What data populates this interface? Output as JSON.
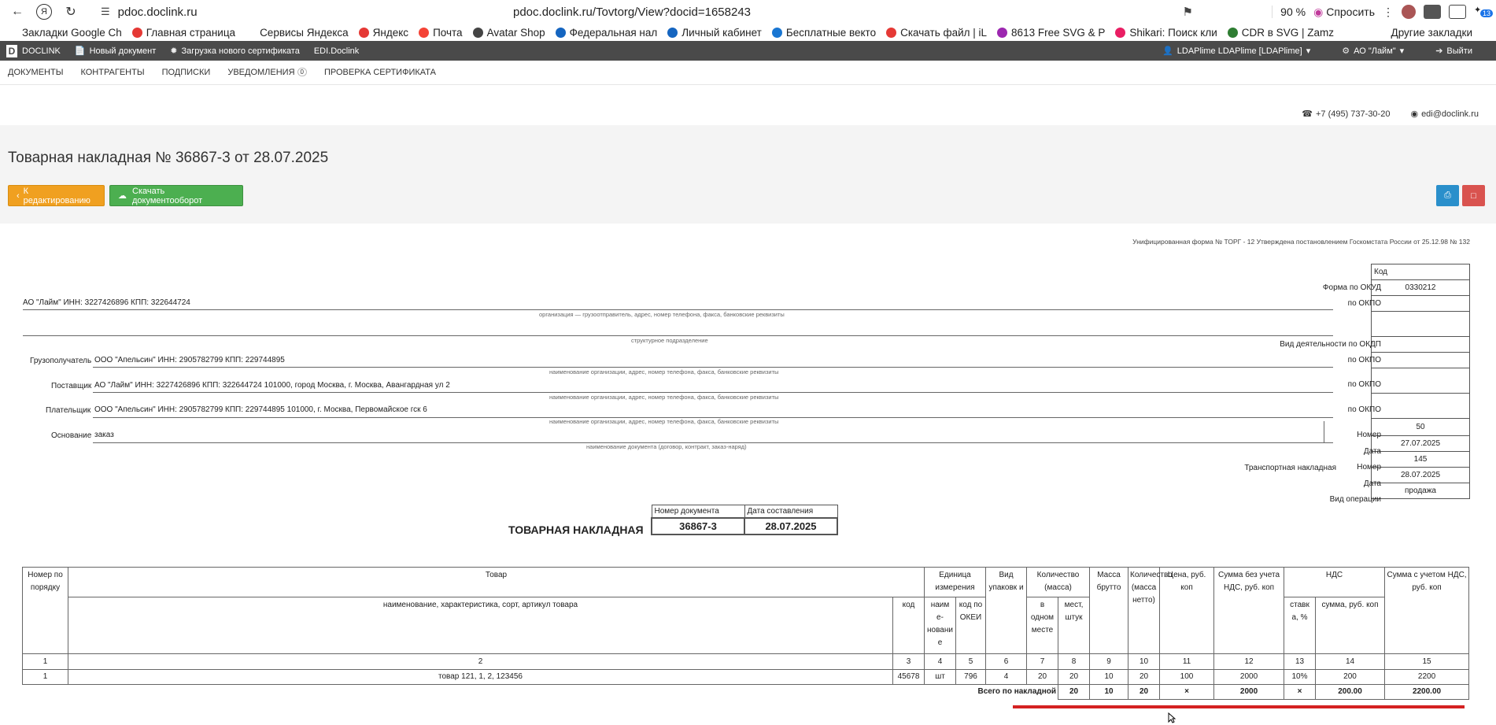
{
  "browser": {
    "host": "pdoc.doclink.ru",
    "url": "pdoc.doclink.ru/Tovtorg/View?docid=1658243",
    "zoom": "90 %",
    "ask": "Спросить",
    "ext_badge": "13"
  },
  "bookmarks": [
    {
      "label": "Закладки Google Ch",
      "color": "#ffffff"
    },
    {
      "label": "Главная страница",
      "color": "#e53935"
    },
    {
      "label": "Сервисы Яндекса",
      "color": "#ffffff"
    },
    {
      "label": "Яндекс",
      "color": "#e53935"
    },
    {
      "label": "Почта",
      "color": "#f44336"
    },
    {
      "label": "Avatar Shop",
      "color": "#444444"
    },
    {
      "label": "Федеральная нал",
      "color": "#1565c0"
    },
    {
      "label": "Личный кабинет",
      "color": "#1565c0"
    },
    {
      "label": "Бесплатные векто",
      "color": "#1976d2"
    },
    {
      "label": "Скачать файл | iL",
      "color": "#e53935"
    },
    {
      "label": "8613 Free SVG & P",
      "color": "#9c27b0"
    },
    {
      "label": "Shikari: Поиск кли",
      "color": "#e91e63"
    },
    {
      "label": "CDR в SVG | Zamz",
      "color": "#2e7d32"
    }
  ],
  "bookmarks_other": "Другие закладки",
  "app": {
    "logo": "DOCLINK",
    "new_doc": "Новый документ",
    "upload_cert": "Загрузка нового сертификата",
    "edi": "EDI.Doclink",
    "user": "LDAPlime LDAPlime [LDAPlime]",
    "org": "АО \"Лайм\"",
    "logout": "Выйти"
  },
  "menu": {
    "documents": "ДОКУМЕНТЫ",
    "contractors": "КОНТРАГЕНТЫ",
    "subscriptions": "ПОДПИСКИ",
    "notifications": "УВЕДОМЛЕНИЯ",
    "notifications_count": "0",
    "cert_check": "ПРОВЕРКА СЕРТИФИКАТА"
  },
  "contacts": {
    "phone": "+7 (495) 737-30-20",
    "email": "edi@doclink.ru"
  },
  "page": {
    "title": "Товарная накладная №  36867-3  от   28.07.2025",
    "btn_edit": "К редактированию",
    "btn_download": "Скачать документооборот"
  },
  "doc": {
    "form_note": "Унифицированная форма № ТОРГ - 12 Утверждена постановлением Госкомстата России от 25.12.98 № 132",
    "shipper": "АО \"Лайм\" ИНН: 3227426896 КПП: 322644724",
    "shipper_hint": "организация — грузоотправитель, адрес, номер телефона, факса, банковские реквизиты",
    "division_hint": "структурное подразделение",
    "consignee_label": "Грузополучатель",
    "consignee": "ООО \"Апельсин\"     ИНН: 2905782799 КПП: 229744895",
    "consignee_hint": "наименование организации, адрес, номер телефона, факса, банковские реквизиты",
    "supplier_label": "Поставщик",
    "supplier": "АО \"Лайм\" ИНН: 3227426896 КПП: 322644724 101000, город Москва, г. Москва, Авангардная ул 2",
    "supplier_hint": "наименование организации, адрес, номер телефона, факса, банковские реквизиты",
    "payer_label": "Плательщик",
    "payer": "ООО \"Апельсин\"     ИНН: 2905782799 КПП: 229744895 101000, г. Москва, Первомайское гск 6",
    "payer_hint": "наименование организации, адрес, номер телефона, факса, банковские реквизиты",
    "basis_label": "Основание",
    "basis": "заказ",
    "basis_hint": "наименование документа (договор, контракт, заказ-наряд)",
    "code_header": "Код",
    "okud_label": "Форма по ОКУД",
    "okud": "0330212",
    "okpo_label": "по ОКПО",
    "okdp_label": "Вид деятельности по ОКДП",
    "number_label": "Номер",
    "number": "50",
    "date_label": "Дата",
    "date": "27.07.2025",
    "transport_label": "Транспортная накладная",
    "transport_number": "145",
    "transport_date": "28.07.2025",
    "operation_label": "Вид операции",
    "operation": "продажа",
    "heading": "ТОВАРНАЯ НАКЛАДНАЯ",
    "docnum_label": "Номер документа",
    "docdate_label": "Дата составления",
    "docnum": "36867-3",
    "docdate": "28.07.2025"
  },
  "table": {
    "h_num": "Номер по порядку",
    "h_goods": "Товар",
    "h_goods_name": "наименование, характеристика, сорт, артикул товара",
    "h_code": "код",
    "h_unit": "Единица измерения",
    "h_unit_name": "наим е-новани е",
    "h_okei": "код по ОКЕИ",
    "h_pack": "Вид упаковк и",
    "h_qty": "Количество (масса)",
    "h_in_one": "в одном месте",
    "h_places": "мест, штук",
    "h_gross": "Масса брутто",
    "h_net": "Количество (масса нетто)",
    "h_price": "Цена, руб. коп",
    "h_sum_novat": "Сумма без учета НДС, руб. коп",
    "h_vat": "НДС",
    "h_rate": "ставк а, %",
    "h_vat_sum": "сумма, руб. коп",
    "h_sum_vat": "Сумма с учетом НДС, руб. коп",
    "col_nums": [
      "1",
      "2",
      "3",
      "4",
      "5",
      "6",
      "7",
      "8",
      "9",
      "10",
      "11",
      "12",
      "13",
      "14",
      "15"
    ],
    "row": [
      "1",
      "товар 121, 1, 2, 123456",
      "45678",
      "шт",
      "796",
      "4",
      "20",
      "20",
      "10",
      "20",
      "100",
      "2000",
      "10%",
      "200",
      "2200"
    ],
    "total_label": "Всего по накладной",
    "total": [
      "20",
      "10",
      "20",
      "×",
      "2000",
      "×",
      "200.00",
      "2200.00"
    ]
  }
}
